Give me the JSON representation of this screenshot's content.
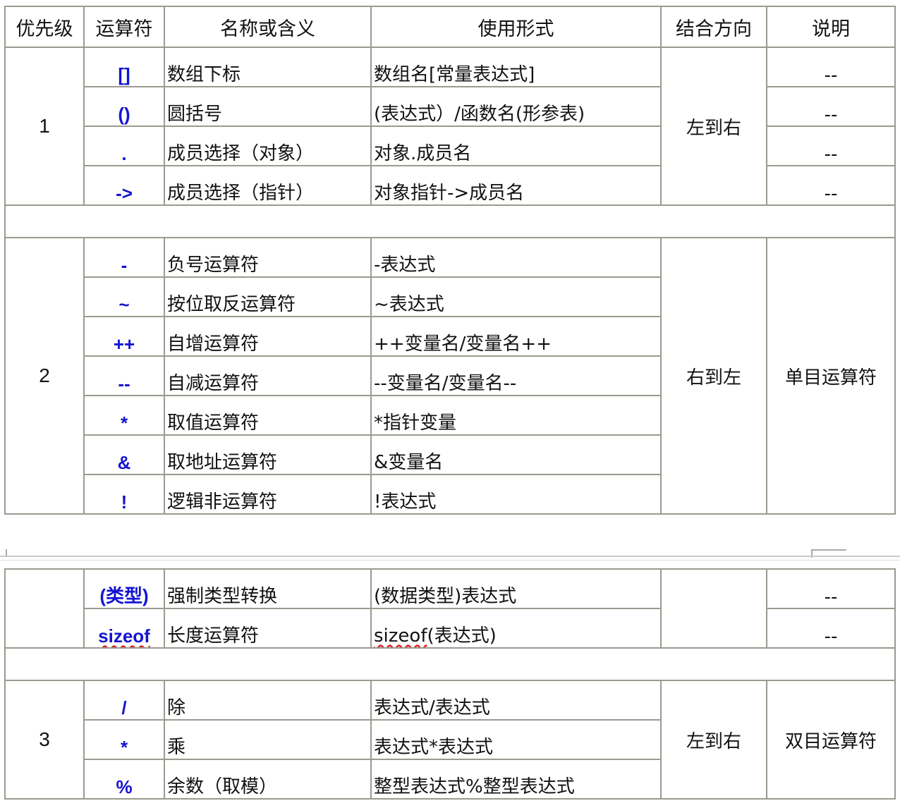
{
  "headers": {
    "priority": "优先级",
    "operator": "运算符",
    "name": "名称或含义",
    "usage": "使用形式",
    "assoc": "结合方向",
    "note": "说明"
  },
  "group1": {
    "priority": "1",
    "assoc": "左到右",
    "rows": [
      {
        "op": "[]",
        "name": "数组下标",
        "usage": "数组名[常量表达式]",
        "note": "--"
      },
      {
        "op": "()",
        "name": "圆括号",
        "usage": "(表达式）/函数名(形参表)",
        "note": "--"
      },
      {
        "op": ".",
        "name": "成员选择（对象）",
        "usage": "对象.成员名",
        "note": "--"
      },
      {
        "op": "->",
        "name": "成员选择（指针）",
        "usage": "对象指针->成员名",
        "note": "--"
      }
    ]
  },
  "group2": {
    "priority": "2",
    "assoc": "右到左",
    "note": "单目运算符",
    "rows": [
      {
        "op": "-",
        "name": "负号运算符",
        "usage": "-表达式"
      },
      {
        "op": "~",
        "name": "按位取反运算符",
        "usage": "~表达式"
      },
      {
        "op": "++",
        "name": "自增运算符",
        "usage": "++变量名/变量名++"
      },
      {
        "op": "--",
        "name": "自减运算符",
        "usage": "--变量名/变量名--"
      },
      {
        "op": "*",
        "name": "取值运算符",
        "usage": "*指针变量"
      },
      {
        "op": "&",
        "name": "取地址运算符",
        "usage": "&变量名"
      },
      {
        "op": "!",
        "name": "逻辑非运算符",
        "usage": "!表达式"
      }
    ]
  },
  "group2cont": {
    "rows": [
      {
        "op": "(类型)",
        "name": "强制类型转换",
        "usage": "(数据类型)表达式",
        "note": "--"
      },
      {
        "op": "sizeof",
        "name": "长度运算符",
        "usage_a": "sizeof",
        "usage_b": "(表达式)",
        "note": "--"
      }
    ]
  },
  "group3": {
    "priority": "3",
    "assoc": "左到右",
    "note": "双目运算符",
    "rows": [
      {
        "op": "/",
        "name": "除",
        "usage": "表达式/表达式"
      },
      {
        "op": "*",
        "name": "乘",
        "usage": "表达式*表达式"
      },
      {
        "op": "%",
        "name": "余数（取模）",
        "usage": "整型表达式%整型表达式"
      }
    ]
  }
}
